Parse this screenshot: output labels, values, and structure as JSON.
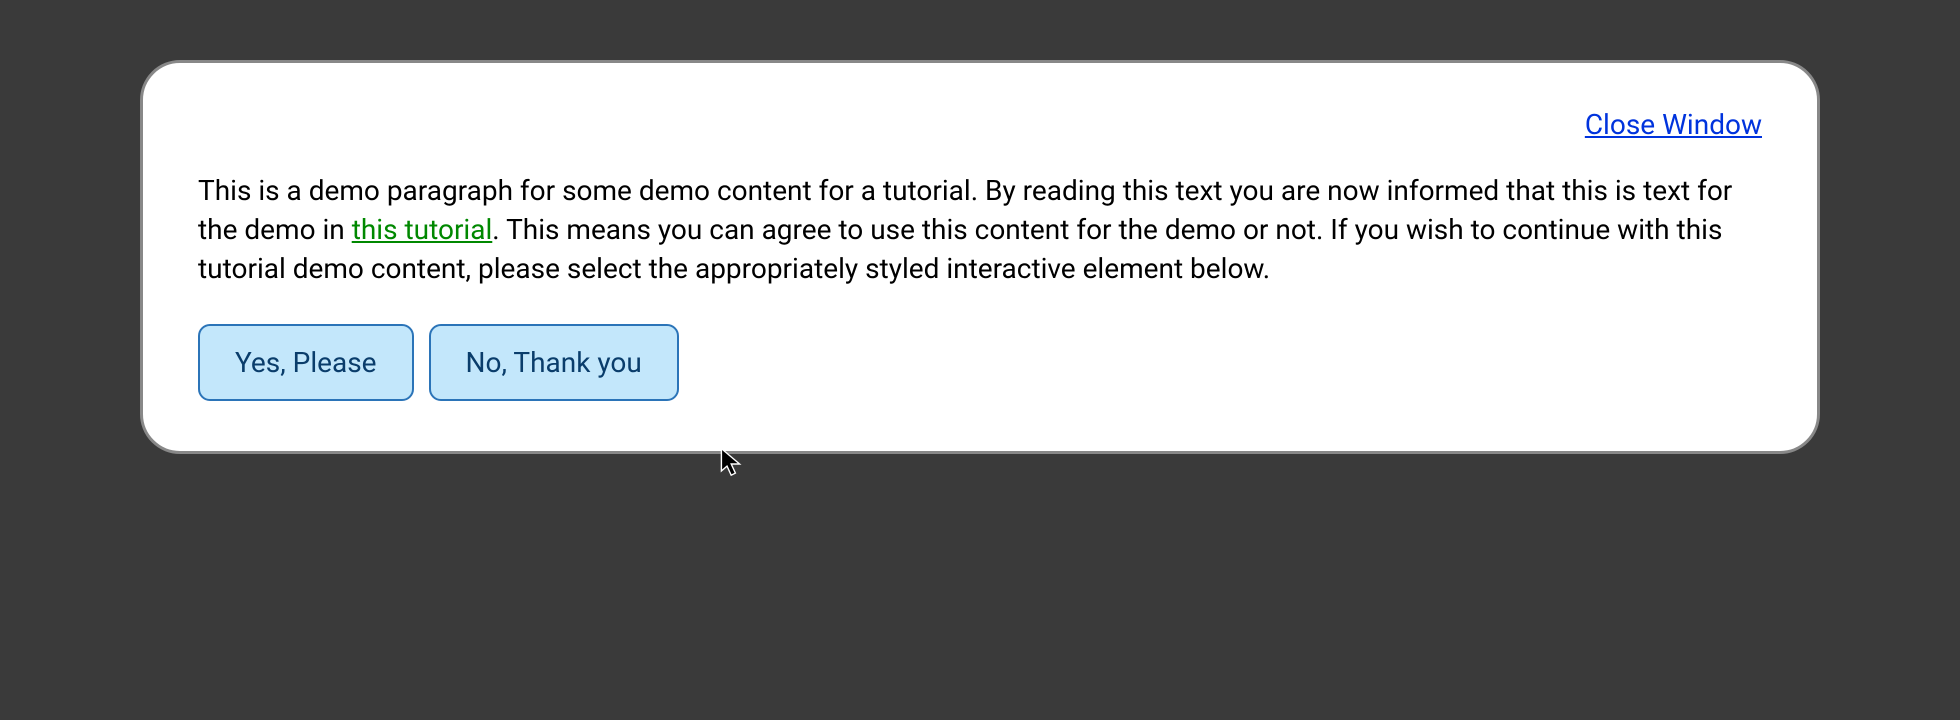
{
  "modal": {
    "close_label": "Close Window",
    "paragraph": {
      "text_before_link": "This is a demo paragraph for some demo content for a tutorial. By reading this text you are now informed that this is text for the demo in ",
      "link_text": "this tutorial",
      "text_after_link": ". This means you can agree to use this content for the demo or not. If you wish to continue with this tutorial demo content, please select the appropriately styled interactive element below."
    },
    "buttons": {
      "yes_label": "Yes, Please",
      "no_label": "No, Thank you"
    }
  }
}
